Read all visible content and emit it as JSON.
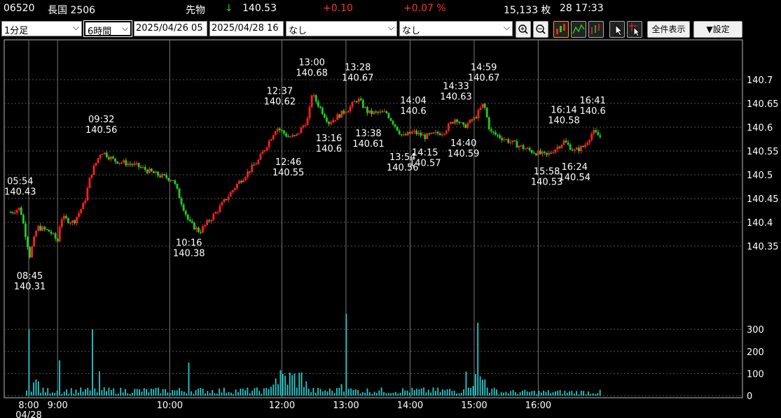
{
  "header": {
    "code": "06520",
    "name": "長国 2506",
    "kind": "先物",
    "arrow": "↓",
    "price": "140.53",
    "change": "+0.10",
    "change_pct": "+0.07 %",
    "volume": "15,133 枚",
    "time": "28 17:33"
  },
  "toolbar": {
    "interval": "1分足",
    "span": "6時間",
    "from": "2025/04/26 05",
    "to": "2025/04/28 16",
    "indicator1": "なし",
    "indicator2": "なし",
    "show_all": "全件表示",
    "settings": "▼設定",
    "icons": [
      "zoom-in-icon",
      "zoom-out-icon",
      "candle-chart-icon",
      "line-chart-icon",
      "bar-chart-icon",
      "cursor-icon",
      "crosshair-cursor-icon"
    ]
  },
  "chart_data": {
    "type": "candlestick",
    "price_axis": {
      "range": [
        140.3,
        140.75
      ],
      "ticks": [
        "140.7",
        "140.65",
        "140.6",
        "140.55",
        "140.5",
        "140.45",
        "140.4",
        "140.35"
      ]
    },
    "volume_axis": {
      "range": [
        0,
        350
      ],
      "ticks": [
        "300",
        "200",
        "100",
        "0"
      ]
    },
    "time_labels": [
      {
        "label": "8:00",
        "t": 0
      },
      {
        "label": "9:00",
        "t": 27
      },
      {
        "label": "10:00",
        "t": 132
      },
      {
        "label": "12:00",
        "t": 237
      },
      {
        "label": "13:00",
        "t": 297
      },
      {
        "label": "14:00",
        "t": 357
      },
      {
        "label": "15:00",
        "t": 417
      },
      {
        "label": "16:00",
        "t": 477
      }
    ],
    "date_label": "04/28",
    "annotations": [
      {
        "time": "05:54",
        "price": "140.43",
        "t": -8,
        "above": true
      },
      {
        "time": "08:45",
        "price": "140.31",
        "t": 1,
        "above": false
      },
      {
        "time": "09:32",
        "price": "140.56",
        "t": 68,
        "above": true
      },
      {
        "time": "10:16",
        "price": "140.38",
        "t": 150,
        "above": false
      },
      {
        "time": "12:37",
        "price": "140.62",
        "t": 235,
        "above": true
      },
      {
        "time": "12:46",
        "price": "140.55",
        "t": 243,
        "above": false
      },
      {
        "time": "13:00",
        "price": "140.68",
        "t": 265,
        "above": true
      },
      {
        "time": "13:16",
        "price": "140.6",
        "t": 281,
        "above": false
      },
      {
        "time": "13:28",
        "price": "140.67",
        "t": 308,
        "above": true
      },
      {
        "time": "13:38",
        "price": "140.61",
        "t": 318,
        "above": false
      },
      {
        "time": "13:54",
        "price": "140.56",
        "t": 350,
        "above": false
      },
      {
        "time": "14:04",
        "price": "140.6",
        "t": 360,
        "above": true
      },
      {
        "time": "14:15",
        "price": "140.57",
        "t": 371,
        "above": false
      },
      {
        "time": "14:33",
        "price": "140.63",
        "t": 400,
        "above": true
      },
      {
        "time": "14:40",
        "price": "140.59",
        "t": 407,
        "above": false
      },
      {
        "time": "14:59",
        "price": "140.67",
        "t": 426,
        "above": true
      },
      {
        "time": "15:58",
        "price": "140.53",
        "t": 485,
        "above": false
      },
      {
        "time": "16:14",
        "price": "140.58",
        "t": 501,
        "above": true
      },
      {
        "time": "16:24",
        "price": "140.54",
        "t": 511,
        "above": false
      },
      {
        "time": "16:41",
        "price": "140.6",
        "t": 528,
        "above": true
      }
    ],
    "colors": {
      "up": "#ff2020",
      "down": "#22cc22",
      "volume": "#22cccc",
      "grid": "#555555",
      "vline": "#777777"
    }
  }
}
